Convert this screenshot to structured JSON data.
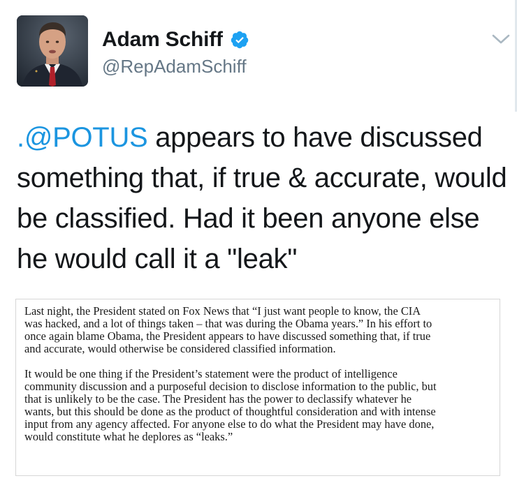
{
  "author": {
    "name": "Adam Schiff",
    "handle": "@RepAdamSchiff",
    "verified": true,
    "verified_icon": "verified-badge-icon",
    "menu_icon": "chevron-down-icon"
  },
  "tweet": {
    "mention": ".@POTUS",
    "text": " appears to have discussed something that, if true & accurate, would be classified. Had it been anyone else he would call it a \"leak\""
  },
  "statement_image": {
    "lines_p1": [
      "Last night, the President stated on Fox News that “I just want people to know, the CIA",
      "was hacked, and a lot of things taken – that was during the Obama years.” In his effort to",
      "once again blame Obama, the President appears to have discussed something that, if true",
      "and accurate, would otherwise be considered classified information."
    ],
    "lines_p2": [
      "It would be one thing if the President’s statement were the product of intelligence",
      "community discussion and a purposeful decision to disclose information to the public, but",
      "that is unlikely to be the case. The President has the power to declassify whatever he",
      "wants, but this should be done as the product of thoughtful consideration and with intense",
      "input from any agency affected. For anyone else to do what the President may have done,",
      "would constitute what he deplores as “leaks.”"
    ]
  },
  "colors": {
    "link": "#1b95e0",
    "verified": "#1da1f2",
    "secondary_text": "#657786"
  }
}
